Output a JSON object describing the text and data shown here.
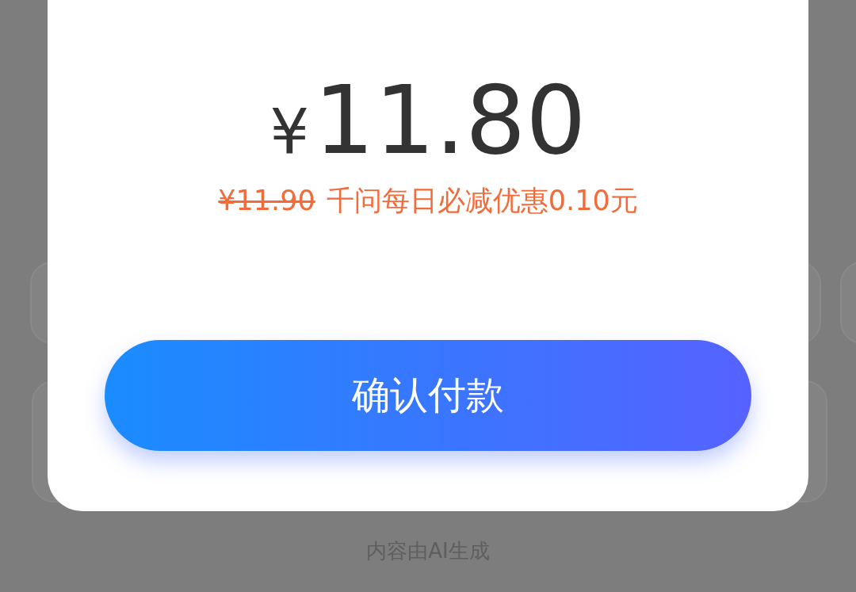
{
  "price": {
    "currency": "¥",
    "amount": "11.80"
  },
  "discount": {
    "original_price": "¥11.90",
    "text": "千问每日必减优惠0.10元"
  },
  "confirm_button": {
    "label": "确认付款"
  },
  "footer_note": "内容由AI生成"
}
